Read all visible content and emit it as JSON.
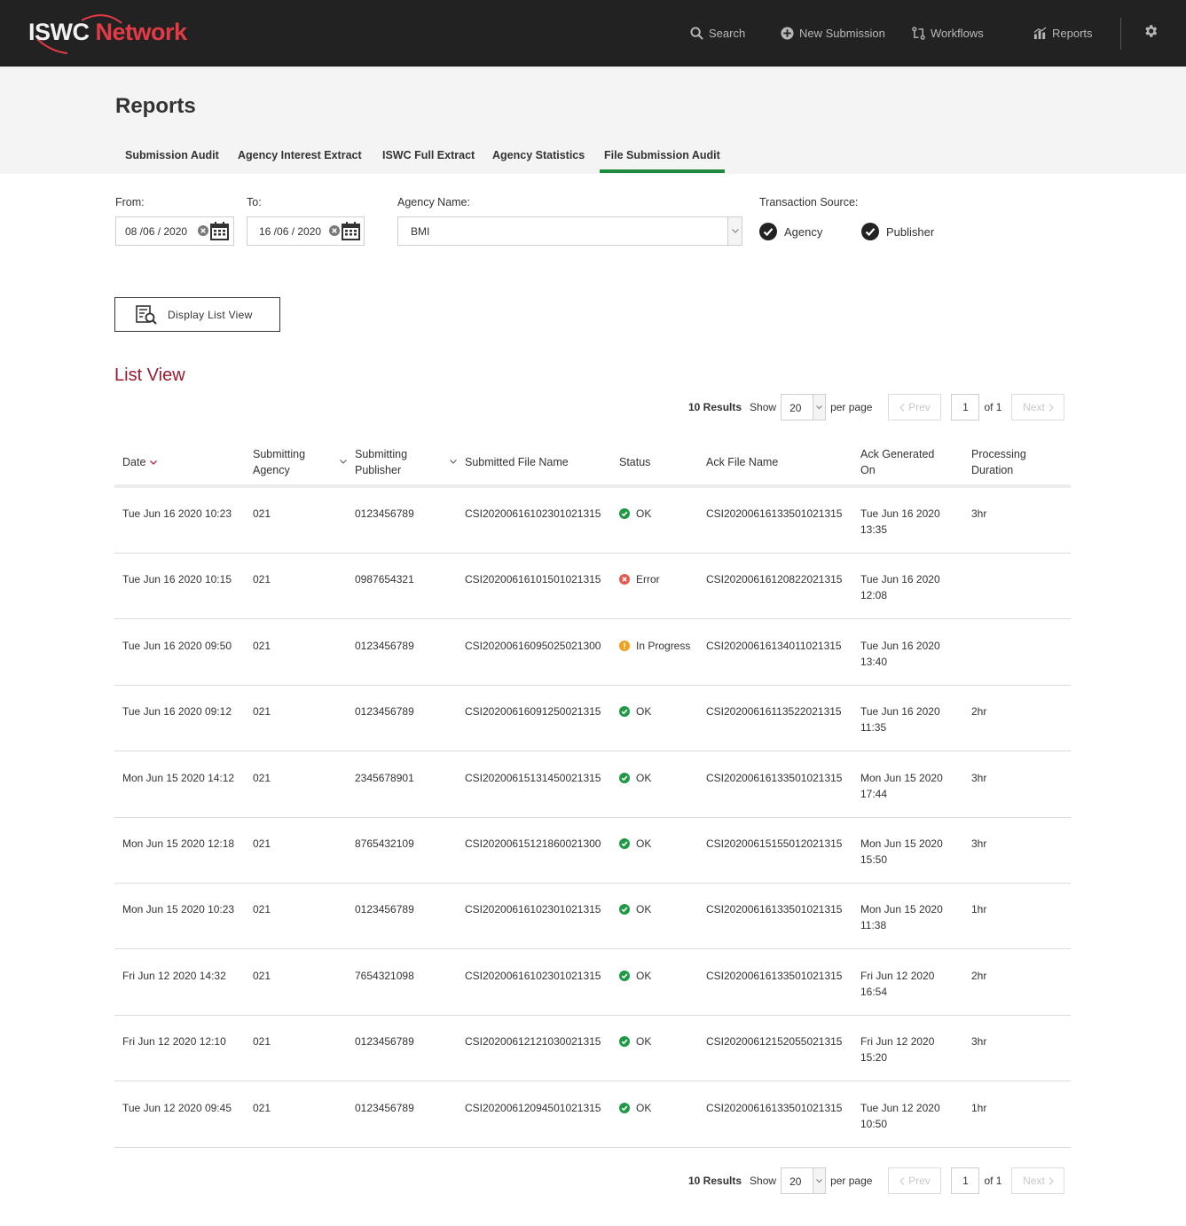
{
  "app": {
    "logo_text_white": "ISWC",
    "logo_text_red": "Network",
    "brand_red": "#e23b45",
    "accent_green": "#1e8a3e",
    "title_red": "#9b1b30"
  },
  "nav": {
    "search": "Search",
    "new_submission": "New Submission",
    "workflows": "Workflows",
    "reports": "Reports"
  },
  "page": {
    "title": "Reports",
    "tabs": [
      "Submission Audit",
      "Agency Interest Extract",
      "ISWC Full Extract",
      "Agency Statistics",
      "File Submission Audit"
    ],
    "active_tab": "File Submission Audit"
  },
  "filters": {
    "from_label": "From:",
    "from_value": "08 /06 / 2020",
    "to_label": "To:",
    "to_value": "16 /06 / 2020",
    "agency_label": "Agency Name:",
    "agency_value": "BMI",
    "source_label": "Transaction Source:",
    "source_agency": "Agency",
    "source_publisher": "Publisher"
  },
  "display_button": "Display List View",
  "list_title": "List View",
  "pagination": {
    "results": "10 Results",
    "show": "Show",
    "per_page_value": "20",
    "per_page": "per page",
    "prev": "Prev",
    "page": "1",
    "of": "of 1",
    "next": "Next"
  },
  "table": {
    "headers": {
      "date": "Date",
      "agency_1": "Submitting",
      "agency_2": "Agency",
      "publisher_1": "Submitting",
      "publisher_2": "Publisher",
      "file": "Submitted File Name",
      "status": "Status",
      "ack": "Ack File Name",
      "ackon_1": "Ack Generated",
      "ackon_2": "On",
      "dur_1": "Processing",
      "dur_2": "Duration"
    },
    "rows": [
      {
        "date": "Tue Jun 16 2020 10:23",
        "agency": "021",
        "publisher": "0123456789",
        "file": "CSI20200616102301021315",
        "status": "OK",
        "status_type": "ok",
        "ack": "CSI20200616133501021315",
        "ack_on_1": "Tue Jun 16 2020",
        "ack_on_2": "13:35",
        "duration": "3hr"
      },
      {
        "date": "Tue Jun 16 2020 10:15",
        "agency": "021",
        "publisher": "0987654321",
        "file": "CSI20200616101501021315",
        "status": "Error",
        "status_type": "error",
        "ack": "CSI20200616120822021315",
        "ack_on_1": "Tue Jun 16 2020",
        "ack_on_2": "12:08",
        "duration": ""
      },
      {
        "date": "Tue Jun 16 2020 09:50",
        "agency": "021",
        "publisher": "0123456789",
        "file": "CSI20200616095025021300",
        "status": "In Progress",
        "status_type": "progress",
        "ack": "CSI20200616134011021315",
        "ack_on_1": "Tue Jun 16 2020",
        "ack_on_2": "13:40",
        "duration": ""
      },
      {
        "date": "Tue Jun 16 2020 09:12",
        "agency": "021",
        "publisher": "0123456789",
        "file": "CSI20200616091250021315",
        "status": "OK",
        "status_type": "ok",
        "ack": "CSI20200616113522021315",
        "ack_on_1": "Tue Jun 16 2020",
        "ack_on_2": "11:35",
        "duration": "2hr"
      },
      {
        "date": "Mon Jun 15 2020 14:12",
        "agency": "021",
        "publisher": "2345678901",
        "file": "CSI20200615131450021315",
        "status": "OK",
        "status_type": "ok",
        "ack": "CSI20200616133501021315",
        "ack_on_1": "Mon Jun 15 2020",
        "ack_on_2": "17:44",
        "duration": "3hr"
      },
      {
        "date": "Mon Jun 15 2020 12:18",
        "agency": "021",
        "publisher": "8765432109",
        "file": "CSI20200615121860021300",
        "status": "OK",
        "status_type": "ok",
        "ack": "CSI20200615155012021315",
        "ack_on_1": "Mon Jun 15 2020",
        "ack_on_2": "15:50",
        "duration": "3hr"
      },
      {
        "date": "Mon Jun 15 2020 10:23",
        "agency": "021",
        "publisher": "0123456789",
        "file": "CSI20200616102301021315",
        "status": "OK",
        "status_type": "ok",
        "ack": "CSI20200616133501021315",
        "ack_on_1": "Mon Jun 15 2020",
        "ack_on_2": "11:38",
        "duration": "1hr"
      },
      {
        "date": "Fri Jun 12 2020 14:32",
        "agency": "021",
        "publisher": "7654321098",
        "file": "CSI20200616102301021315",
        "status": "OK",
        "status_type": "ok",
        "ack": "CSI20200616133501021315",
        "ack_on_1": "Fri Jun 12 2020",
        "ack_on_2": "16:54",
        "duration": "2hr"
      },
      {
        "date": "Fri Jun 12 2020 12:10",
        "agency": "021",
        "publisher": "0123456789",
        "file": "CSI20200612121030021315",
        "status": "OK",
        "status_type": "ok",
        "ack": "CSI20200612152055021315",
        "ack_on_1": "Fri Jun 12 2020",
        "ack_on_2": "15:20",
        "duration": "3hr"
      },
      {
        "date": "Tue Jun 12 2020 09:45",
        "agency": "021",
        "publisher": "0123456789",
        "file": "CSI20200612094501021315",
        "status": "OK",
        "status_type": "ok",
        "ack": "CSI20200616133501021315",
        "ack_on_1": "Tue Jun 12 2020",
        "ack_on_2": "10:50",
        "duration": "1hr"
      }
    ]
  }
}
